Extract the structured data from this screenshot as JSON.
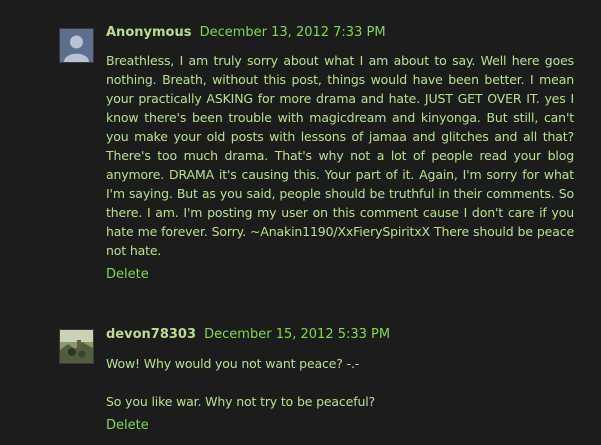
{
  "comments": [
    {
      "author": "Anonymous",
      "timestamp": "December 13, 2012 7:33 PM",
      "avatar": "default-user-icon",
      "paragraphs": [
        "Breathless, I am truly sorry about what I am about to say. Well here goes nothing. Breath, without this post, things would have been better. I mean your practically ASKING for more drama and hate. JUST GET OVER IT. yes I know there's been trouble with magicdream and kinyonga. But still, can't you make your old posts with lessons of jamaa and glitches and all that? There's too much drama. That's why not a lot of people read your blog anymore. DRAMA it's causing this. Your part of it. Again, I'm sorry for what I'm saying. But as you said, people should be truthful in their comments. So there. I am. I'm posting my user on this comment cause I don't care if you hate me forever. Sorry. ~Anakin1190/XxFierySpiritxX There should be peace not hate."
      ],
      "delete_label": "Delete"
    },
    {
      "author": "devon78303",
      "timestamp": "December 15, 2012 5:33 PM",
      "avatar": "user-photo",
      "paragraphs": [
        "Wow! Why would you not want peace? -.-",
        "So you like war. Why not try to be peaceful?"
      ],
      "delete_label": "Delete"
    }
  ],
  "colors": {
    "background": "#1c1c1c",
    "text": "#b6e28a",
    "link": "#7fdc45"
  }
}
